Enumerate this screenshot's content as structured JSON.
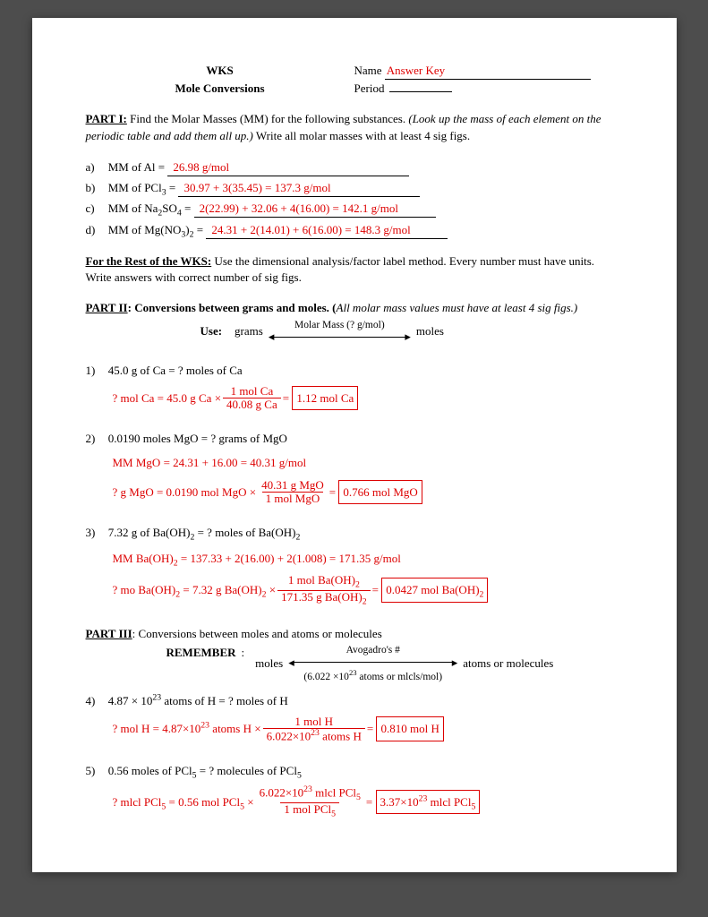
{
  "header": {
    "wks": "WKS",
    "title": "Mole Conversions",
    "name_label": "Name",
    "name_value": "Answer Key",
    "period_label": "Period"
  },
  "part1": {
    "heading": "PART I:",
    "intro1": " Find the Molar Masses (MM) for the following substances.  ",
    "intro_italic": "(Look up the mass of each element on the periodic table and add them all up.)",
    "intro2": " Write all molar masses with at least 4 sig figs.",
    "items": [
      {
        "marker": "a)",
        "label": "MM of Al = ",
        "answer": "26.98 g/mol"
      },
      {
        "marker": "b)",
        "label_pre": "MM of PCl",
        "label_sub": "3",
        "label_post": " = ",
        "answer": "30.97 + 3(35.45) = 137.3 g/mol"
      },
      {
        "marker": "c)",
        "label_pre": "MM of Na",
        "label_sub": "2",
        "label_mid": "SO",
        "label_sub2": "4",
        "label_post": " = ",
        "answer": "2(22.99) + 32.06 + 4(16.00) = 142.1 g/mol"
      },
      {
        "marker": "d)",
        "label_pre": "MM of Mg(NO",
        "label_sub": "3",
        "label_mid": ")",
        "label_sub2": "2",
        "label_post": " = ",
        "answer": "24.31 + 2(14.01) + 6(16.00) = 148.3 g/mol"
      }
    ]
  },
  "rest": {
    "heading": "For the Rest of the WKS:",
    "text": "  Use the dimensional analysis/factor label method.  Every number must have units.  Write answers with correct number of sig figs."
  },
  "part2": {
    "heading": "PART II",
    "heading2": ": Conversions between grams and moles.  (",
    "italic": "All molar mass values must have at least 4 sig figs.)",
    "use": "Use:",
    "left": "grams",
    "mid": "Molar Mass (? g/mol)",
    "right": "moles"
  },
  "q1": {
    "marker": "1)",
    "prompt": "45.0 g of Ca  = ?  moles of Ca",
    "work_left": "?  mol Ca = 45.0 g Ca ×",
    "frac_num": "1 mol Ca",
    "frac_den": "40.08 g Ca",
    "equals": "=",
    "box": "1.12 mol Ca"
  },
  "q2": {
    "marker": "2)",
    "prompt": "0.0190 moles MgO  =   ? grams of MgO",
    "mm_line": "MM MgO = 24.31 + 16.00 = 40.31 g/mol",
    "work_left": "?  g MgO = 0.0190 mol MgO ×",
    "frac_num": "40.31 g MgO",
    "frac_den": "1 mol MgO",
    "equals": "=",
    "box": "0.766 mol MgO"
  },
  "q3": {
    "marker": "3)",
    "prompt_pre": "7.32 g of Ba(OH)",
    "prompt_sub": "2",
    "prompt_post": " = ?  moles of Ba(OH)",
    "prompt_sub2": "2",
    "mm_line_pre": "MM Ba(OH)",
    "mm_line_sub": "2",
    "mm_line_post": " = 137.33 + 2(16.00) + 2(1.008) = 171.35 g/mol",
    "work_left_pre": "?  mo Ba(OH)",
    "work_left_sub": "2",
    "work_left_mid": " = 7.32 g Ba(OH)",
    "work_left_sub2": "2",
    "work_left_post": " ×",
    "frac_num_pre": "1 mol Ba(OH)",
    "frac_num_sub": "2",
    "frac_den_pre": "171.35 g Ba(OH)",
    "frac_den_sub": "2",
    "equals": "=",
    "box_pre": "0.0427 mol Ba(OH)",
    "box_sub": "2"
  },
  "part3": {
    "heading": "PART III",
    "heading2": ": Conversions between moles and atoms or molecules",
    "remember": "REMEMBER",
    "left": "moles",
    "mid_top": "Avogadro's #",
    "mid_bot_pre": "(6.022 ×10",
    "mid_bot_sup": "23",
    "mid_bot_post": "  atoms or mlcls/mol)",
    "right": "atoms or molecules"
  },
  "q4": {
    "marker": "4)",
    "prompt_pre": "4.87 × 10",
    "prompt_sup": "23",
    "prompt_post": " atoms of H = ?  moles of H",
    "work_left_pre": "?  mol H = 4.87×10",
    "work_left_sup": "23",
    "work_left_post": "  atoms H ×",
    "frac_num": "1 mol H",
    "frac_den_pre": "6.022×10",
    "frac_den_sup": "23",
    "frac_den_post": "  atoms H",
    "equals": "=",
    "box": "0.810 mol H"
  },
  "q5": {
    "marker": "5)",
    "prompt_pre": "0.56 moles of PCl",
    "prompt_sub": "5",
    "prompt_mid": " = ?  molecules of PCl",
    "prompt_sub2": "5",
    "work_left_pre": "?  mlcl PCl",
    "work_left_sub": "5",
    "work_left_mid": " = 0.56 mol PCl",
    "work_left_sub2": "5",
    "work_left_post": " ×",
    "frac_num_pre": "6.022×10",
    "frac_num_sup": "23",
    "frac_num_mid": "  mlcl PCl",
    "frac_num_sub": "5",
    "frac_den_pre": "1 mol PCl",
    "frac_den_sub": "5",
    "equals": "=",
    "box_pre": "3.37×10",
    "box_sup": "23",
    "box_mid": "  mlcl PCl",
    "box_sub": "5"
  }
}
